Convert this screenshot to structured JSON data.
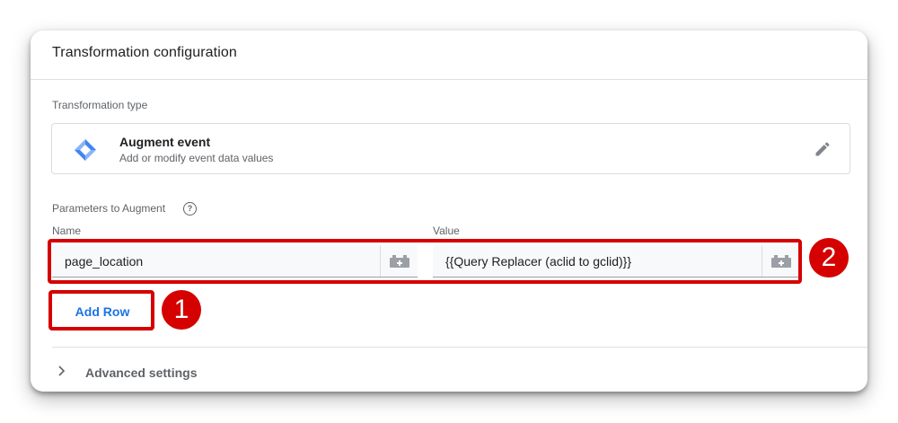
{
  "card": {
    "title": "Transformation configuration"
  },
  "transformation_type": {
    "section_label": "Transformation type",
    "name": "Augment event",
    "description": "Add or modify event data values",
    "icon": "augment-event-icon",
    "edit_icon": "pencil-icon"
  },
  "parameters": {
    "section_label": "Parameters to Augment",
    "help_icon": "help-circle-icon",
    "name_column": "Name",
    "value_column": "Value",
    "rows": [
      {
        "name": "page_location",
        "value": "{{Query Replacer (aclid to gclid)}}"
      }
    ],
    "variable_icon": "variable-picker-icon",
    "add_row_label": "Add Row"
  },
  "annotations": {
    "callout_1": "1",
    "callout_2": "2",
    "highlight_color": "#d50000"
  },
  "advanced": {
    "label": "Advanced settings",
    "icon": "chevron-right-icon"
  },
  "colors": {
    "accent": "#1a73e8",
    "text": "#202124",
    "secondary_text": "#5f6368"
  }
}
